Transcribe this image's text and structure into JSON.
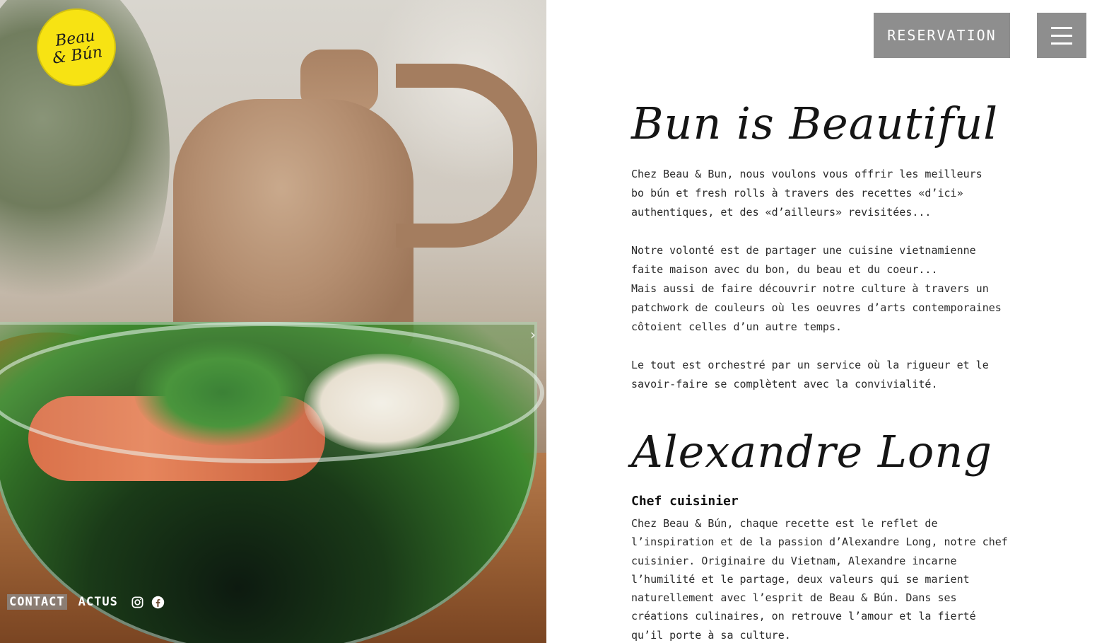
{
  "brand": {
    "logo_line1": "Beau",
    "logo_line2": "& Bún",
    "logo_color": "#f7e313"
  },
  "hero": {
    "next_arrow_icon": "chevron-right-icon"
  },
  "footer": {
    "contact_label": "CONTACT",
    "actus_label": "ACTUS",
    "instagram_icon": "instagram-icon",
    "facebook_icon": "facebook-icon"
  },
  "header": {
    "reservation_label": "RESERVATION",
    "menu_icon": "hamburger-menu-icon",
    "button_color": "#8e8e8e"
  },
  "main": {
    "title_1": "Bun is Beautiful",
    "paragraph_1": "Chez Beau & Bun, nous voulons vous offrir les meilleurs\nbo bún et fresh rolls à travers des recettes «d’ici»\nauthentiques, et des «d’ailleurs» revisitées...",
    "paragraph_2": "Notre volonté est de partager une cuisine vietnamienne\nfaite maison avec du bon, du beau et du coeur...\nMais aussi de faire découvrir notre culture à travers un\npatchwork de couleurs où les oeuvres d’arts contemporaines\ncôtoient celles d’un autre temps.",
    "paragraph_3": "Le tout est orchestré par un service où la rigueur et le\nsavoir-faire se complètent avec la convivialité.",
    "title_2": "Alexandre Long",
    "chef_role": "Chef cuisinier",
    "paragraph_4": "Chez Beau & Bún, chaque recette est le reflet de\nl’inspiration et de la passion d’Alexandre Long, notre chef\ncuisinier. Originaire du Vietnam, Alexandre incarne\nl’humilité et le partage, deux valeurs qui se marient\nnaturellement avec l’esprit de Beau & Bún. Dans ses\ncréations culinaires, on retrouve l’amour et la fierté\nqu’il porte à sa culture."
  }
}
